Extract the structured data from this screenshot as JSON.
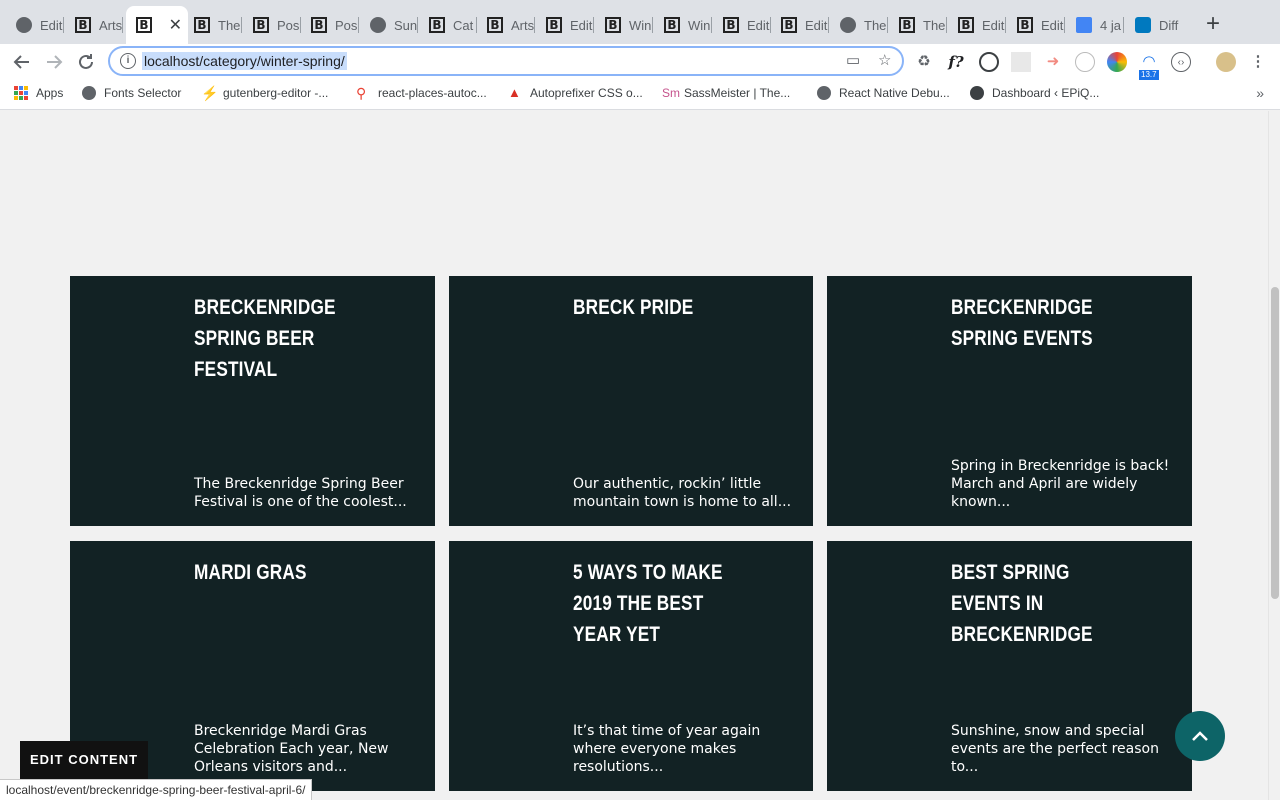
{
  "browser": {
    "tabs": [
      {
        "title": "Edit",
        "favicon": "globe"
      },
      {
        "title": "Arts",
        "favicon": "b"
      },
      {
        "title": "",
        "favicon": "b",
        "active": true
      },
      {
        "title": "The",
        "favicon": "b"
      },
      {
        "title": "Pos",
        "favicon": "b"
      },
      {
        "title": "Pos",
        "favicon": "b"
      },
      {
        "title": "Sun",
        "favicon": "globe"
      },
      {
        "title": "Cat",
        "favicon": "b"
      },
      {
        "title": "Arts",
        "favicon": "b"
      },
      {
        "title": "Edit",
        "favicon": "b"
      },
      {
        "title": "Win",
        "favicon": "b"
      },
      {
        "title": "Win",
        "favicon": "b"
      },
      {
        "title": "Edit",
        "favicon": "b"
      },
      {
        "title": "Edit",
        "favicon": "b"
      },
      {
        "title": "The",
        "favicon": "globe"
      },
      {
        "title": "The",
        "favicon": "b"
      },
      {
        "title": "Edit",
        "favicon": "b"
      },
      {
        "title": "Edit",
        "favicon": "b"
      },
      {
        "title": "4 ja",
        "favicon": "gdoc"
      },
      {
        "title": "Diff",
        "favicon": "trello"
      }
    ],
    "url": "localhost/category/winter-spring/",
    "extension_badge": "13.7",
    "bookmarks": [
      {
        "label": "Apps",
        "icon": "apps-grid-icon"
      },
      {
        "label": "Fonts Selector",
        "icon": "globe-icon"
      },
      {
        "label": "gutenberg-editor -...",
        "icon": "bolt-icon"
      },
      {
        "label": "react-places-autoc...",
        "icon": "map-pin-icon"
      },
      {
        "label": "Autoprefixer CSS o...",
        "icon": "autoprefixer-icon"
      },
      {
        "label": "SassMeister | The...",
        "icon": "sassmeister-icon"
      },
      {
        "label": "React Native Debu...",
        "icon": "globe-icon"
      },
      {
        "label": "Dashboard ‹ EPiQ...",
        "icon": "wordpress-icon"
      }
    ]
  },
  "cards": [
    {
      "title": "Breckenridge Spring Beer Festival",
      "excerpt": "The Breckenridge Spring Beer Festival is one of the coolest..."
    },
    {
      "title": "Breck Pride",
      "excerpt": "Our authentic, rockin’ little mountain town is home to all..."
    },
    {
      "title": "Breckenridge Spring Events",
      "excerpt": "Spring in Breckenridge is back! March and April are widely known..."
    },
    {
      "title": "Mardi Gras",
      "excerpt": "Breckenridge Mardi Gras Celebration Each year, New Orleans visitors and..."
    },
    {
      "title": "5 Ways to Make 2019 the Best Year Yet",
      "excerpt": "It’s that time of year again where everyone makes resolutions..."
    },
    {
      "title": "Best Spring Events in Breckenridge",
      "excerpt": "Sunshine, snow and special events are the perfect reason to..."
    }
  ],
  "edit_content_label": "EDIT CONTENT",
  "status_url": "localhost/event/breckenridge-spring-beer-festival-april-6/",
  "colors": {
    "card_bg": "#122224",
    "to_top_bg": "#0d6467"
  }
}
